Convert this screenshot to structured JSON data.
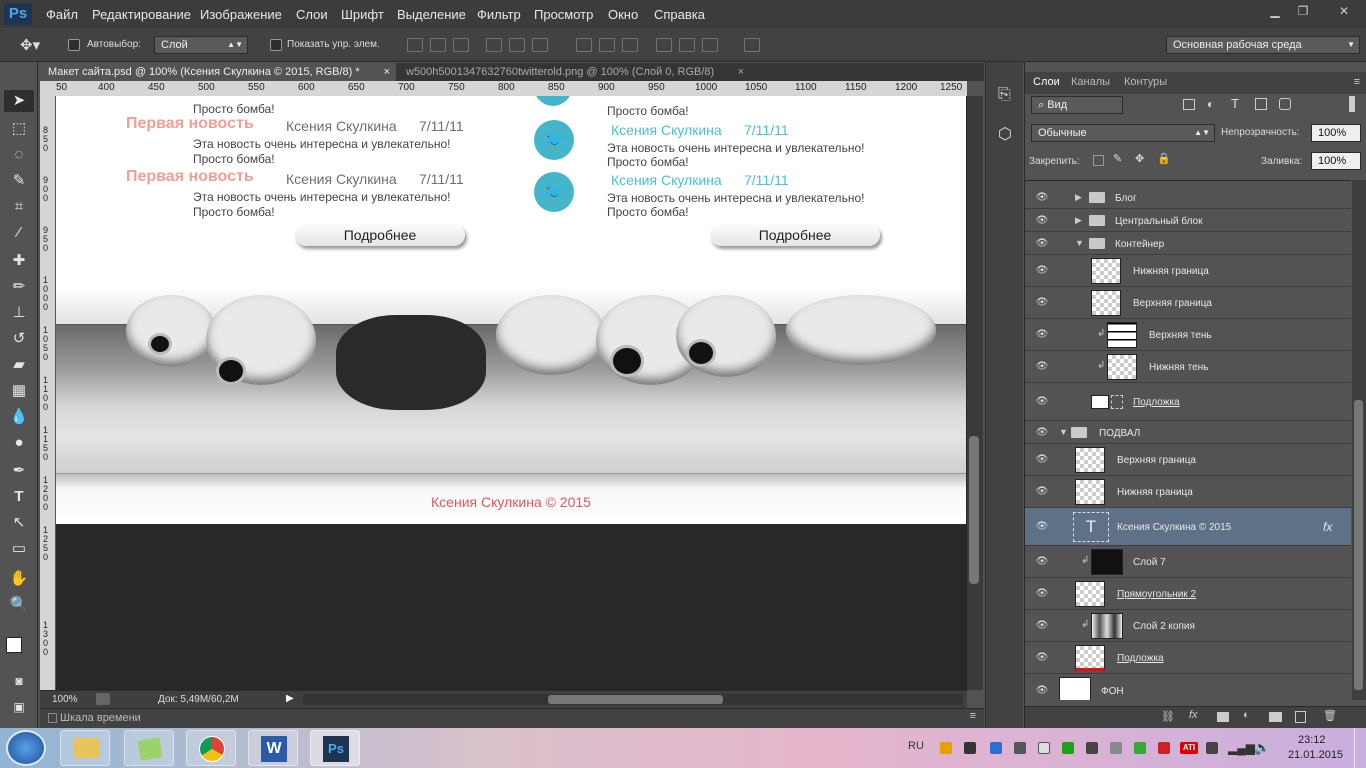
{
  "app": {
    "logo": "Ps"
  },
  "menu": [
    "Файл",
    "Редактирование",
    "Изображение",
    "Слои",
    "Шрифт",
    "Выделение",
    "Фильтр",
    "Просмотр",
    "Окно",
    "Справка"
  ],
  "options": {
    "autoselect_label": "Автовыбор:",
    "autoselect_value": "Слой",
    "show_controls_label": "Показать упр. элем.",
    "workspace": "Основная рабочая среда"
  },
  "tabs": [
    {
      "label": "Макет сайта.psd @ 100% (Ксения Скулкина © 2015, RGB/8) *",
      "close": "×",
      "active": true
    },
    {
      "label": "w500h5001347632760twitterold.png @ 100% (Слой 0, RGB/8)",
      "close": "×",
      "active": false
    }
  ],
  "ruler_h": [
    "50",
    "400",
    "450",
    "500",
    "550",
    "600",
    "650",
    "700",
    "750",
    "800",
    "850",
    "900",
    "950",
    "1000",
    "1050",
    "1100",
    "1150",
    "1200",
    "1250"
  ],
  "ruler_v": [
    "8 5 0",
    "9 0 0",
    "9 5 0",
    "1 0 0 0",
    "1 0 5 0",
    "1 1 0 0",
    "1 1 5 0",
    "1 2 0 0",
    "1 2 5 0",
    "1 3 0 0"
  ],
  "doc": {
    "news": [
      {
        "title": "",
        "author": "",
        "date": "",
        "text1": "",
        "text2": "Просто бомба!"
      },
      {
        "title": "Первая новость",
        "author": "Ксения Скулкина",
        "date": "7/11/11",
        "text1": "Эта новость очень интересна и увлекательно!",
        "text2": "Просто бомба!"
      },
      {
        "title": "Первая новость",
        "author": "Ксения Скулкина",
        "date": "7/11/11",
        "text1": "Эта новость очень интересна и увлекательно!",
        "text2": "Просто бомба!"
      }
    ],
    "tweets": [
      {
        "author": "",
        "date": "",
        "text1": "",
        "text2": "Просто бомба!"
      },
      {
        "author": "Ксения Скулкина",
        "date": "7/11/11",
        "text1": "Эта новость очень интересна и увлекательно!",
        "text2": "Просто бомба!"
      },
      {
        "author": "Ксения Скулкина",
        "date": "7/11/11",
        "text1": "Эта новость очень интересна и увлекательно!",
        "text2": "Просто бомба!"
      }
    ],
    "more_button": "Подробнее",
    "copyright": "Ксения Скулкина © 2015"
  },
  "status": {
    "zoom": "100%",
    "doc": "Док: 5,49M/60,2M"
  },
  "timeline": "Шкала времени",
  "panel": {
    "tabs": [
      "Слои",
      "Каналы",
      "Контуры"
    ],
    "filter": "Вид",
    "blend": "Обычные",
    "opacity_label": "Непрозрачность:",
    "opacity": "100%",
    "lock_label": "Закрепить:",
    "fill_label": "Заливка:",
    "fill": "100%"
  },
  "layers": [
    {
      "name": "Блог",
      "kind": "group"
    },
    {
      "name": "Центральный блок",
      "kind": "group"
    },
    {
      "name": "Контейнер",
      "kind": "group-open"
    },
    {
      "name": "Нижняя граница",
      "kind": "layer"
    },
    {
      "name": "Верхняя граница",
      "kind": "layer"
    },
    {
      "name": "Верхняя тень",
      "kind": "clip"
    },
    {
      "name": "Нижняя тень",
      "kind": "clip"
    },
    {
      "name": "Подложка",
      "kind": "mask"
    },
    {
      "name": "ПОДВАЛ",
      "kind": "group-open"
    },
    {
      "name": "Верхняя граница",
      "kind": "layer"
    },
    {
      "name": "Нижняя граница",
      "kind": "layer"
    },
    {
      "name": "Ксения Скулкина © 2015",
      "kind": "text",
      "fx": "fx"
    },
    {
      "name": "Слой 7",
      "kind": "clip"
    },
    {
      "name": "Прямоугольник 2",
      "kind": "layer"
    },
    {
      "name": "Слой 2 копия",
      "kind": "clip"
    },
    {
      "name": "Подложка",
      "kind": "layer"
    },
    {
      "name": "ФОН",
      "kind": "bg"
    }
  ],
  "tray": {
    "lang": "RU",
    "time": "23:12",
    "date": "21.01.2015"
  },
  "colors": {
    "accent_pink": "#f19f95",
    "accent_teal": "#49c0d2",
    "copyright": "#e0575a",
    "selected_row": "#5e7186"
  }
}
